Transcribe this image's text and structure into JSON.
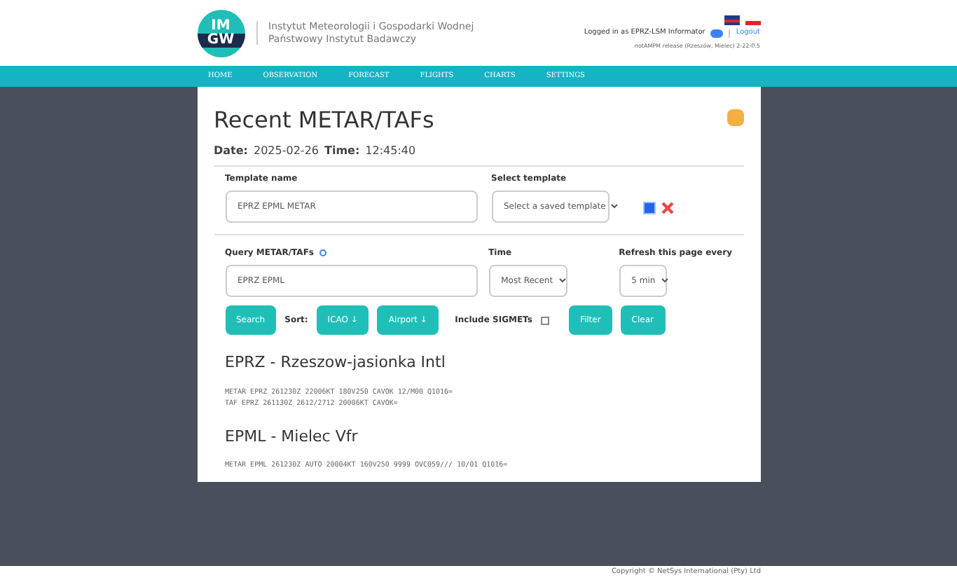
{
  "header": {
    "logo": {
      "top": "IM",
      "bottom": "GW"
    },
    "org_line1": "Instytut Meteorologii i Gospodarki Wodnej",
    "org_line2": "Państwowy Instytut Badawczy",
    "logged_in": "Logged in as EPRZ-LSM Informator",
    "logout": "Logout",
    "release": "notAMPM release (Rzeszów, Mielec) 2-22-0.5"
  },
  "nav": [
    {
      "label": "HOME"
    },
    {
      "label": "OBSERVATION"
    },
    {
      "label": "FORECAST"
    },
    {
      "label": "FLIGHTS"
    },
    {
      "label": "CHARTS"
    },
    {
      "label": "SETTINGS"
    }
  ],
  "page": {
    "title": "Recent METAR/TAFs",
    "date_label": "Date:",
    "date": "2025-02-26",
    "time_label": "Time:",
    "time": "12:45:40",
    "template_name_label": "Template name",
    "template_name": "EPRZ EPML METAR",
    "select_template_label": "Select template",
    "select_template": "Select a saved template",
    "query_label": "Query METAR/TAFs",
    "query": "EPRZ EPML",
    "time_field_label": "Time",
    "time_value": "Most Recent",
    "refresh_label": "Refresh this page every",
    "refresh_value": "5 min",
    "search_button": "Search",
    "sort_label": "Sort:",
    "sort_buttons": [
      "ICAO ↓",
      "Airport ↓"
    ],
    "sigmets_label": "Include SIGMETs",
    "sigmets_checked": false,
    "filter_button": "Filter",
    "clear_button": "Clear"
  },
  "stations": [
    {
      "name": "EPRZ - Rzeszow-jasionka Intl",
      "reports": [
        "METAR EPRZ 261230Z 22006KT 180V250 CAVOK 12/M00 Q1016=",
        "TAF EPRZ 261130Z 2612/2712 20006KT CAVOK="
      ]
    },
    {
      "name": "EPML - Mielec Vfr",
      "reports": [
        "METAR EPML 261230Z AUTO 20004KT 160V250 9999 OVC059/// 10/01 Q1016="
      ]
    }
  ],
  "footer": "Copyright © NetSys International (Pty) Ltd"
}
